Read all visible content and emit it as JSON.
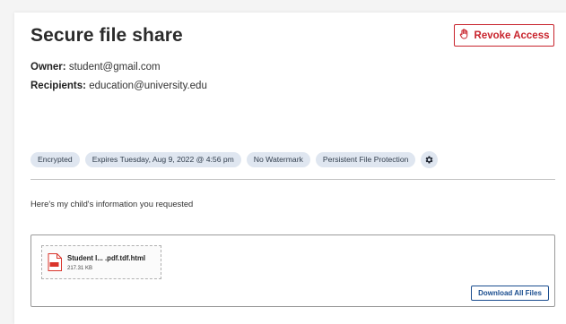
{
  "page": {
    "title": "Secure file share"
  },
  "actions": {
    "revoke_label": "Revoke Access",
    "download_all_label": "Download All Files"
  },
  "share": {
    "owner_label": "Owner:",
    "owner_value": "student@gmail.com",
    "recipients_label": "Recipients:",
    "recipients_value": "education@university.edu"
  },
  "tags": [
    "Encrypted",
    "Expires Tuesday, Aug 9, 2022 @ 4:56 pm",
    "No Watermark",
    "Persistent File Protection"
  ],
  "message": "Here's my child's information you requested",
  "files": [
    {
      "name": "Student I... .pdf.tdf.html",
      "size": "217.31 KB",
      "icon": "pdf-file-icon",
      "icon_text": "PDF"
    }
  ],
  "colors": {
    "revoke": "#c8232c",
    "tag_bg": "#dfe6f0",
    "download": "#1a4d8f"
  }
}
